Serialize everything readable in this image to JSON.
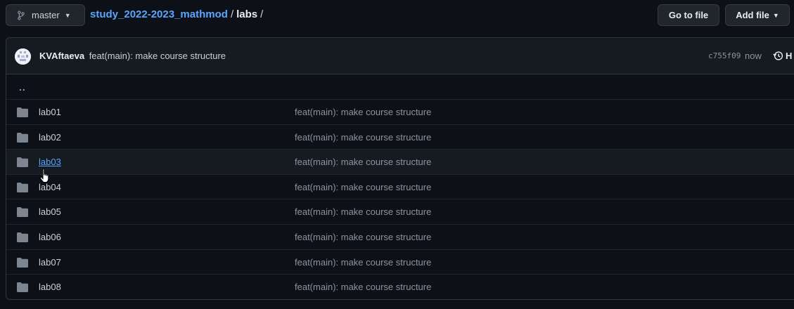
{
  "header": {
    "branch": "master",
    "repo": "study_2022-2023_mathmod",
    "separator": "/",
    "current_dir": "labs",
    "trailing_sep": "/",
    "go_to_file": "Go to file",
    "add_file": "Add file"
  },
  "commit": {
    "author": "KVAftaeva",
    "message": "feat(main): make course structure",
    "sha": "c755f09",
    "time": "now",
    "history_label": "H"
  },
  "files": {
    "parent": "..",
    "items": [
      {
        "name": "lab01",
        "message": "feat(main): make course structure"
      },
      {
        "name": "lab02",
        "message": "feat(main): make course structure"
      },
      {
        "name": "lab03",
        "message": "feat(main): make course structure"
      },
      {
        "name": "lab04",
        "message": "feat(main): make course structure"
      },
      {
        "name": "lab05",
        "message": "feat(main): make course structure"
      },
      {
        "name": "lab06",
        "message": "feat(main): make course structure"
      },
      {
        "name": "lab07",
        "message": "feat(main): make course structure"
      },
      {
        "name": "lab08",
        "message": "feat(main): make course structure"
      }
    ]
  },
  "colors": {
    "background": "#0d1117",
    "link": "#58a6ff",
    "folder": "#7d8590",
    "muted": "#8b949e"
  },
  "icons": [
    "git-branch-icon",
    "chevron-down-icon",
    "folder-icon",
    "history-icon",
    "pointer-cursor-icon"
  ]
}
